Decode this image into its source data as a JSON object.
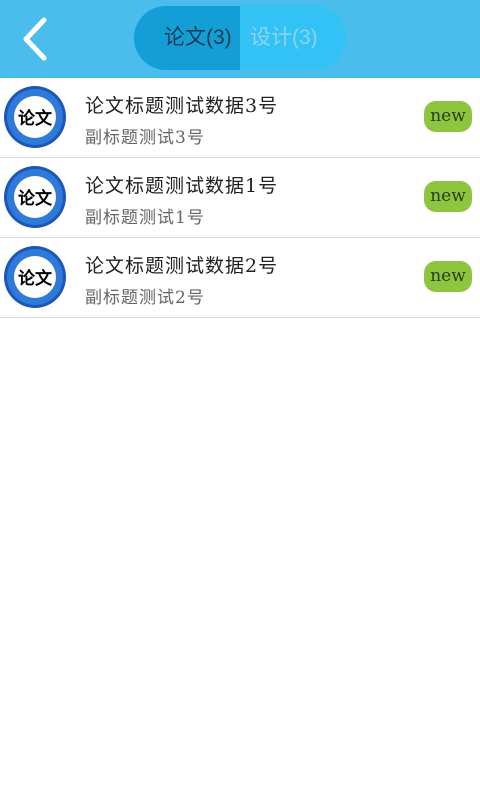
{
  "header": {
    "tabs": [
      {
        "label": "论文(3)",
        "active": true
      },
      {
        "label": "设计(3)",
        "active": false
      }
    ],
    "background_color": "#4bbdec"
  },
  "list": {
    "items": [
      {
        "icon_text": "论文",
        "title": "论文标题测试数据3号",
        "subtitle": "副标题测试3号",
        "badge": "new"
      },
      {
        "icon_text": "论文",
        "title": "论文标题测试数据1号",
        "subtitle": "副标题测试1号",
        "badge": "new"
      },
      {
        "icon_text": "论文",
        "title": "论文标题测试数据2号",
        "subtitle": "副标题测试2号",
        "badge": "new"
      }
    ]
  },
  "colors": {
    "badge": "#8dc53e",
    "active_tab": "#139ed6"
  }
}
